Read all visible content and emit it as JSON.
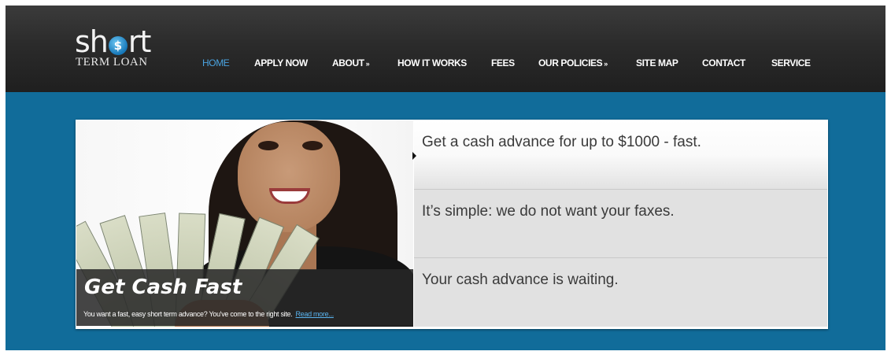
{
  "logo": {
    "text_top_start": "sh",
    "text_top_end": "rt",
    "logo_o": "$",
    "text_bottom": "TERM LOAN"
  },
  "nav": [
    {
      "label": "HOME",
      "active": true
    },
    {
      "label": "APPLY NOW"
    },
    {
      "label": "ABOUT",
      "dropdown": "»"
    },
    {
      "label": "HOW IT WORKS"
    },
    {
      "label": "FEES"
    },
    {
      "label": "OUR POLICIES",
      "dropdown": "»"
    },
    {
      "label": "SITE MAP"
    },
    {
      "label": "CONTACT"
    },
    {
      "label": "SERVICE"
    }
  ],
  "slide": {
    "caption_title": "Get Cash Fast",
    "caption_text": "You want a fast, easy short term advance? You've come to the right site.",
    "read_more": "Read more..."
  },
  "tabs": [
    {
      "text": "Get a cash advance for up to $1000 - fast."
    },
    {
      "text": "It’s simple: we do not want your faxes."
    },
    {
      "text": "Your cash advance is waiting."
    }
  ],
  "colors": {
    "header": "#2b2b2b",
    "background": "#116c9a",
    "active_nav": "#4aa3e0",
    "link": "#5ab4f0"
  }
}
